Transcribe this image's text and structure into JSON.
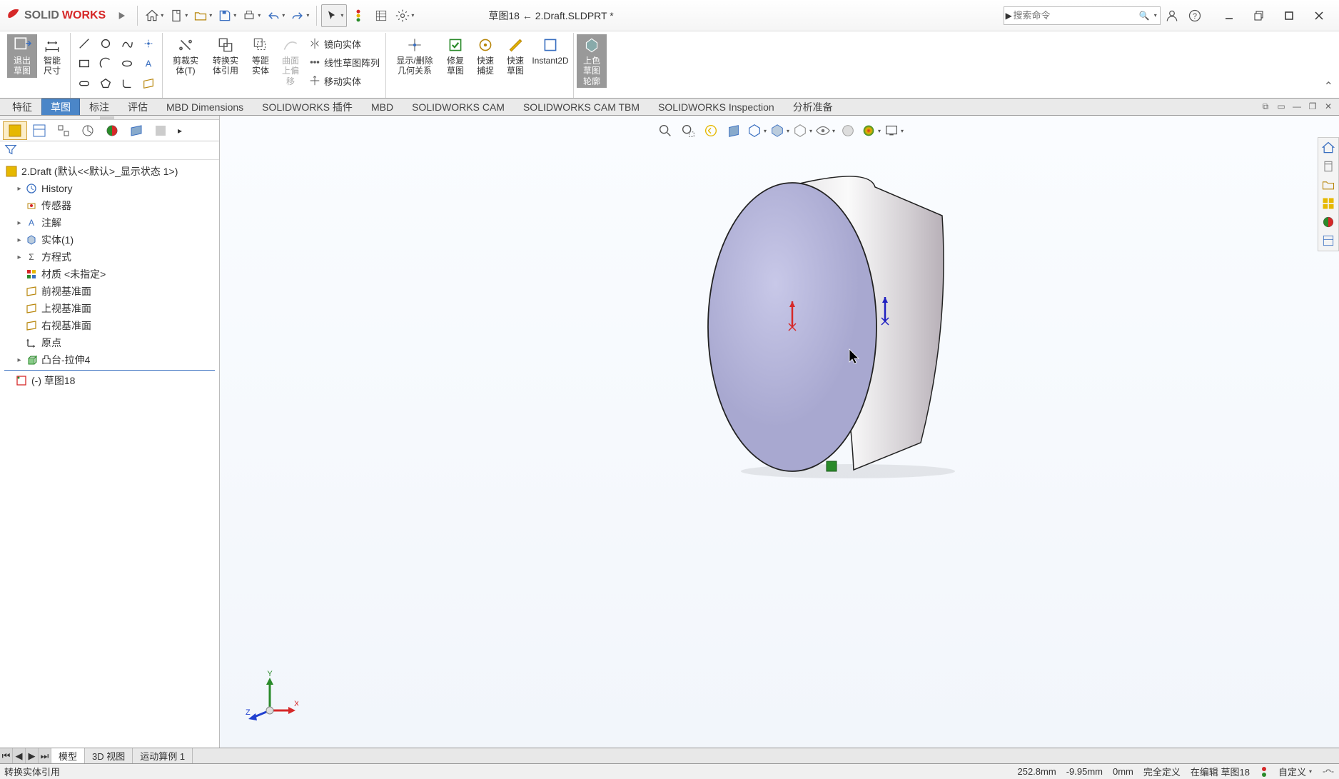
{
  "app": {
    "brand_solid": "SOLID",
    "brand_works": "WORKS",
    "doc_title": "草图18 ← 2.Draft.SLDPRT *",
    "search_placeholder": "搜索命令"
  },
  "ribbon": {
    "exit_sketch": "退出\n草图",
    "smart_dim": "智能\n尺寸",
    "trim": "剪裁实\n体(T)",
    "convert": "转换实\n体引用",
    "offset": "等距\n实体",
    "curve_offset": "曲面\n上偏\n移",
    "mirror": "镜向实体",
    "pattern": "线性草图阵列",
    "move": "移动实体",
    "show_rel": "显示/删除\n几何关系",
    "repair": "修复\n草图",
    "quick_snap": "快速\n捕捉",
    "quick_sketch": "快速\n草图",
    "instant2d": "Instant2D",
    "shade_outline": "上色\n草图\n轮廓"
  },
  "tabs": {
    "items": [
      "特征",
      "草图",
      "标注",
      "评估",
      "MBD Dimensions",
      "SOLIDWORKS 插件",
      "MBD",
      "SOLIDWORKS CAM",
      "SOLIDWORKS CAM TBM",
      "SOLIDWORKS Inspection",
      "分析准备"
    ],
    "active_index": 1
  },
  "tree": {
    "root": "2.Draft  (默认<<默认>_显示状态 1>)",
    "items": [
      {
        "label": "History",
        "expandable": true,
        "icon": "history"
      },
      {
        "label": "传感器",
        "expandable": false,
        "icon": "sensor"
      },
      {
        "label": "注解",
        "expandable": true,
        "icon": "annot"
      },
      {
        "label": "实体(1)",
        "expandable": true,
        "icon": "solid"
      },
      {
        "label": "方程式",
        "expandable": true,
        "icon": "equation"
      },
      {
        "label": "材质 <未指定>",
        "expandable": false,
        "icon": "material"
      },
      {
        "label": "前视基准面",
        "expandable": false,
        "icon": "plane"
      },
      {
        "label": "上视基准面",
        "expandable": false,
        "icon": "plane"
      },
      {
        "label": "右视基准面",
        "expandable": false,
        "icon": "plane"
      },
      {
        "label": "原点",
        "expandable": false,
        "icon": "origin"
      },
      {
        "label": "凸台-拉伸4",
        "expandable": true,
        "icon": "extrude"
      }
    ],
    "current": "(-) 草图18"
  },
  "bottom_tabs": {
    "items": [
      "模型",
      "3D 视图",
      "运动算例 1"
    ],
    "active_index": 0
  },
  "status": {
    "left": "转换实体引用",
    "x": "252.8mm",
    "y": "-9.95mm",
    "z": "0mm",
    "def": "完全定义",
    "editing": "在编辑 草图18",
    "custom": "自定义"
  },
  "colors": {
    "red": "#d62828",
    "blue": "#3a6fc0",
    "green": "#2a8a2a"
  }
}
